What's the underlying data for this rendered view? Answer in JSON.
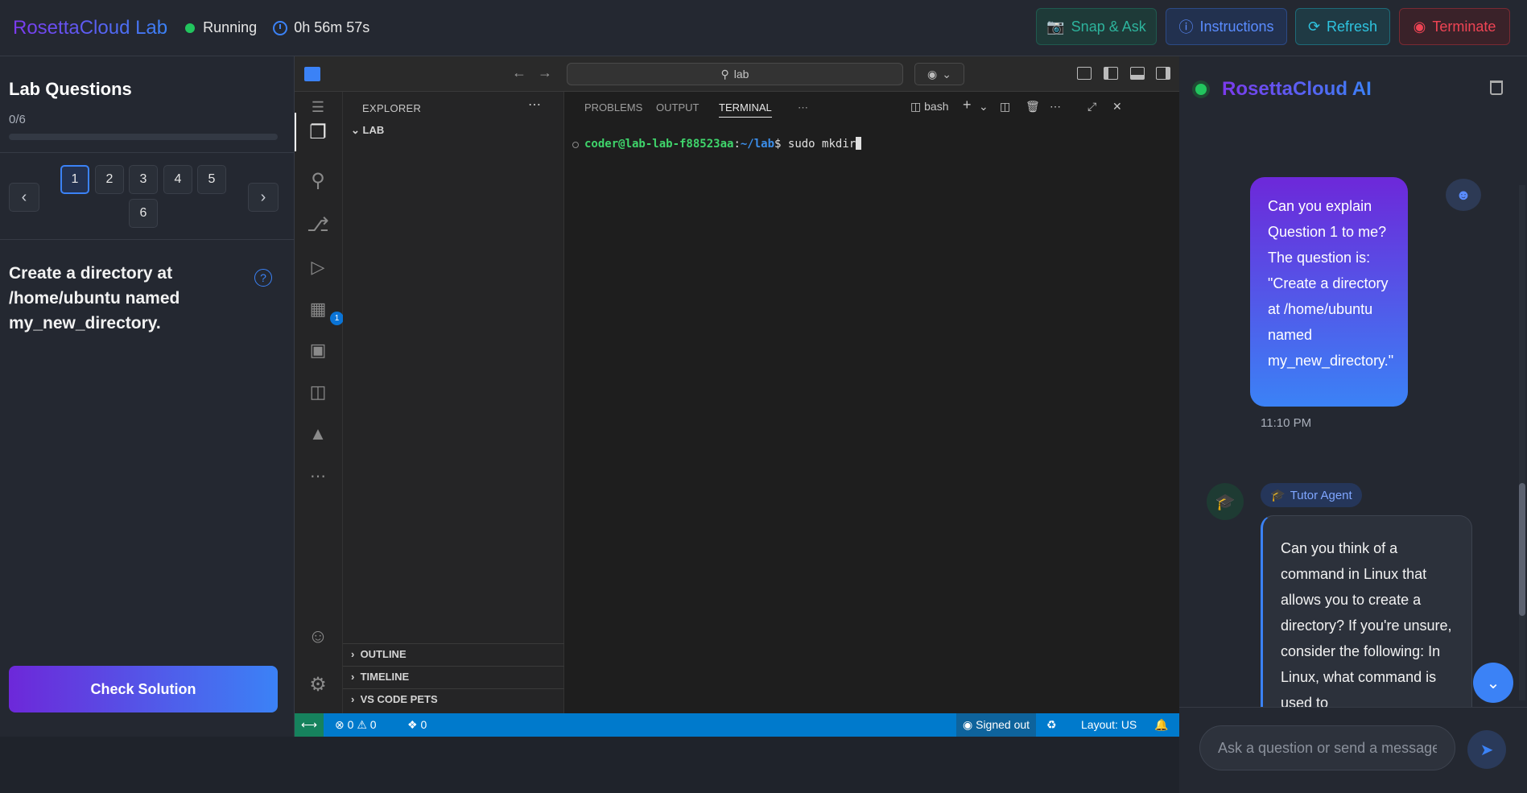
{
  "topbar": {
    "brand": "RosettaCloud Lab",
    "status": "Running",
    "timer": "0h 56m 57s",
    "buttons": {
      "snap": "Snap & Ask",
      "instructions": "Instructions",
      "refresh": "Refresh",
      "terminate": "Terminate"
    }
  },
  "left": {
    "title": "Lab Questions",
    "progress": "0/6",
    "progress_fraction": 0,
    "questions": [
      "1",
      "2",
      "3",
      "4",
      "5",
      "6"
    ],
    "active_question": "1",
    "question_text": "Create a directory at /home/ubuntu named my_new_directory.",
    "help_icon": "?",
    "check_button": "Check Solution"
  },
  "vscode": {
    "search": "lab",
    "sidebar": {
      "title": "EXPLORER",
      "folder": "LAB",
      "sections": [
        "OUTLINE",
        "TIMELINE",
        "VS CODE PETS"
      ]
    },
    "panel_tabs": [
      "PROBLEMS",
      "OUTPUT",
      "TERMINAL"
    ],
    "active_tab": "TERMINAL",
    "shell": "bash",
    "terminal": {
      "user_host": "coder@lab-lab-f88523aa",
      "path": "~/lab",
      "prompt_suffix": "$ ",
      "command": "sudo mkdir"
    },
    "extensions_badge": "1",
    "statusbar": {
      "errors": "0",
      "warnings": "0",
      "ports": "0",
      "account": "Signed out",
      "layout": "Layout: US"
    }
  },
  "chat": {
    "title": "RosettaCloud AI",
    "user_message": "Can you explain Question 1 to me? The question is: \"Create a directory at /home/ubuntu named my_new_directory.\"",
    "time": "11:10 PM",
    "agent_label": "Tutor Agent",
    "agent_message": "Can you think of a command in Linux that allows you to create a directory? If you're unsure, consider the following: In Linux, what command is used to",
    "input_placeholder": "Ask a question or send a message"
  },
  "colors": {
    "accent": "#3b82f6",
    "brand_start": "#7c3aed",
    "running": "#22c55e",
    "terminate": "#ef4454",
    "statusbar": "#007acc"
  }
}
